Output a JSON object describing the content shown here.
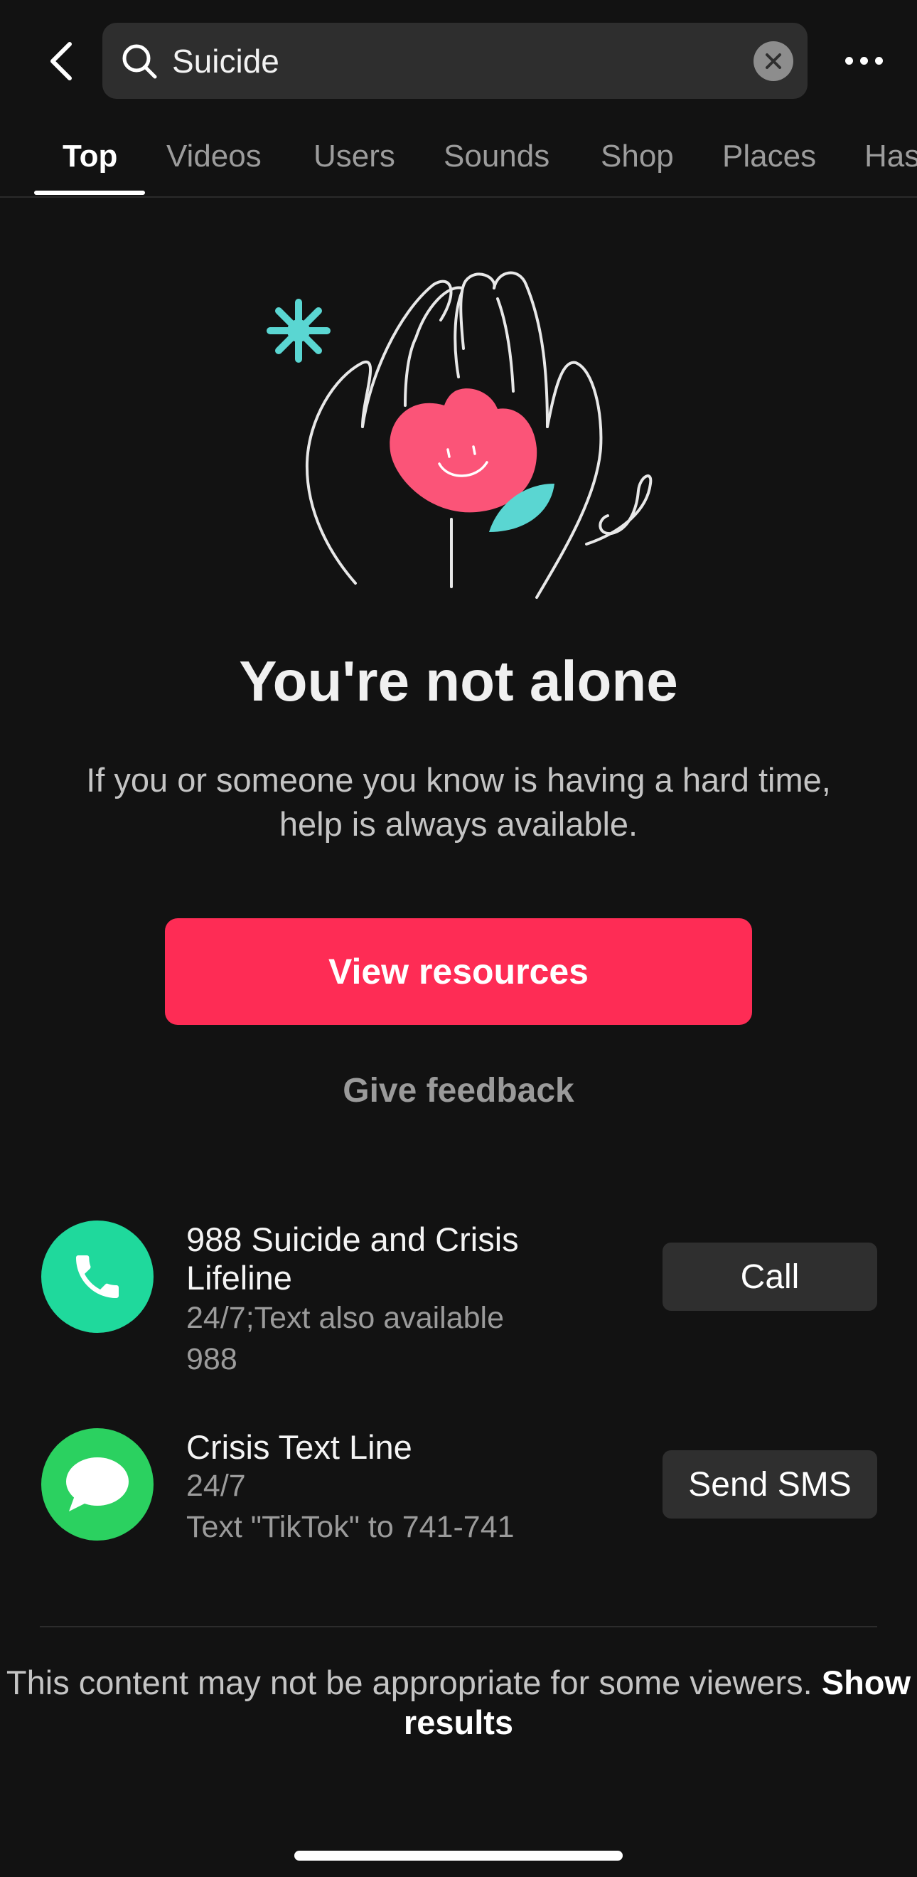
{
  "search": {
    "query": "Suicide"
  },
  "tabs": [
    {
      "label": "Top"
    },
    {
      "label": "Videos"
    },
    {
      "label": "Users"
    },
    {
      "label": "Sounds"
    },
    {
      "label": "Shop"
    },
    {
      "label": "Places"
    },
    {
      "label": "Has"
    }
  ],
  "intervention": {
    "headline": "You're not alone",
    "body": "If you or someone you know is having a hard time, help is always available.",
    "primary_button": "View resources",
    "feedback_link": "Give feedback"
  },
  "resources": [
    {
      "title": "988 Suicide and Crisis Lifeline",
      "lines": [
        "24/7;Text also available",
        "988"
      ],
      "action": "Call",
      "icon": "phone-icon",
      "color": "#1fd99c"
    },
    {
      "title": "Crisis Text Line",
      "lines": [
        "24/7",
        "Text \"TikTok\" to 741-741"
      ],
      "action": "Send SMS",
      "icon": "message-bubble-icon",
      "color": "#2bd160"
    }
  ],
  "notice": {
    "text": "This content may not be appropriate for some viewers.",
    "link": "Show results"
  },
  "colors": {
    "accent": "#fe2c55",
    "background": "#121212"
  }
}
